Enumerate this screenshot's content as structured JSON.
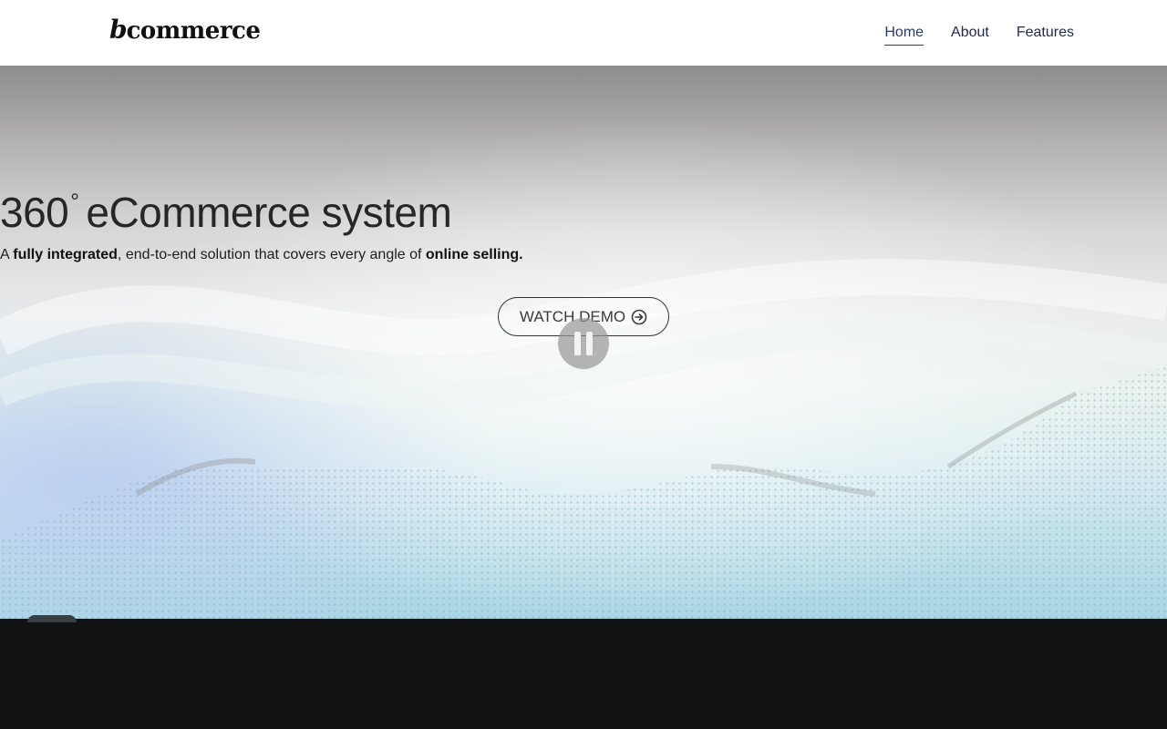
{
  "header": {
    "logo_mark": "b",
    "logo_text": "commerce",
    "nav": [
      {
        "label": "Home",
        "active": true
      },
      {
        "label": "About",
        "active": false
      },
      {
        "label": "Features",
        "active": false
      }
    ]
  },
  "hero": {
    "headline_number": "360",
    "headline_degree": "°",
    "headline_text": "eCommerce system",
    "sub_prefix": "A ",
    "sub_bold_1": "fully integrated",
    "sub_middle": ", end-to-end solution that covers every angle of ",
    "sub_bold_2": "online selling.",
    "cta_label": "WATCH DEMO",
    "cta_icon": "arrow-right-circle-icon",
    "video_control_icon": "pause-icon"
  },
  "colors": {
    "nav_text": "#1f2752",
    "background_dark": "#111214",
    "headline": "#262626"
  }
}
